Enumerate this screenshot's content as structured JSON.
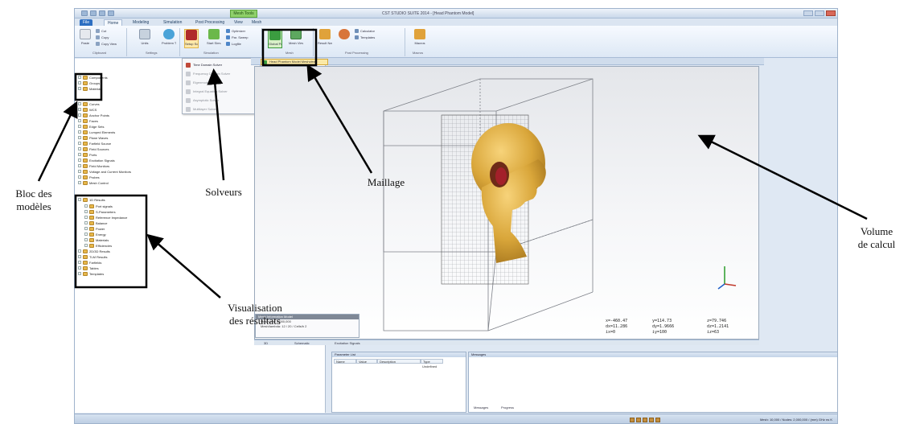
{
  "window": {
    "title": "CST STUDIO SUITE 2014 - [Head Phantom Model]",
    "context_tab": "Mesh Tools"
  },
  "ribbon": {
    "tabs": [
      "File",
      "Home",
      "Modeling",
      "Simulation",
      "Post Processing",
      "View",
      "Mesh"
    ],
    "groups": [
      "Clipboard",
      "Settings",
      "Simulation",
      "Mesh",
      "Post Processing",
      "Macros"
    ],
    "buttons": {
      "paste": "Paste",
      "units": "Units",
      "problem_type": "Problem Type",
      "setup_solver": "Setup Solver",
      "start_simulation": "Start Simulation",
      "global_properties": "Global Properties",
      "mesh_view": "Mesh View",
      "result_navigator": "Result Navigator",
      "macros": "Macros"
    },
    "small_buttons": [
      "Cut",
      "Copy",
      "Copy View",
      "Optimizer",
      "Par. Sweep",
      "Logfile",
      "Calculator",
      "Templates",
      "Results Templates"
    ]
  },
  "solver_menu": {
    "items": [
      "Time Domain Solver",
      "Frequency Domain Solver",
      "Eigenmode Solver",
      "Integral Equation Solver",
      "Asymptotic Solver",
      "Multilayer Solver"
    ]
  },
  "tree": {
    "model_block": [
      "Components",
      "Groups",
      "Materials"
    ],
    "items": [
      "Curves",
      "WCS",
      "Anchor Points",
      "Faces",
      "Edge Sets",
      "Lumped Elements",
      "Plane Waves",
      "Farfield Source",
      "Field Sources",
      "Ports",
      "Excitation Signals",
      "Field Monitors",
      "Voltage and Current Monitors",
      "Probes",
      "Mesh Control"
    ],
    "results_root": "1D Results",
    "results": [
      "Port signals",
      "S-Parameters",
      "Reference Impedance",
      "Balance",
      "Power",
      "Energy",
      "Materials",
      "Efficiencies"
    ],
    "after_results": [
      "2D/3D Results",
      "TLM Results",
      "Farfields",
      "Tables",
      "Templates"
    ]
  },
  "viewport": {
    "tab_label": "Head Phantom Model Meshview",
    "coords": {
      "x": "x=-460.47",
      "dx": "dx=11.286",
      "ix": "ix=0",
      "y": "y=114.73",
      "dy": "dy=1.9666",
      "iy": "iy=100",
      "z": "z=79.746",
      "dz": "dz=1.2141",
      "iz": "iz=63"
    },
    "info": {
      "title": "Mesh Information Model",
      "rows": [
        "Meshcells:    2,000,000",
        "Mesh/lambda:    12 / 20 / Cells/h 2"
      ]
    },
    "bottom_tabs": [
      "3D",
      "Schematic",
      "Excitation Signals"
    ]
  },
  "parameters": {
    "title": "Parameter List",
    "headers": [
      "Name",
      "Value",
      "Description",
      "Type"
    ],
    "rows": [
      [
        "",
        "",
        "",
        "Undefined"
      ]
    ]
  },
  "messages": {
    "title": "Messages",
    "tabs": [
      "Messages",
      "Progress"
    ]
  },
  "status": {
    "text": "Mesh: 10,000 / Nodes: 2,000,000 / (mm)  GHz  ns  K"
  },
  "annotations": {
    "model_block": [
      "Bloc des",
      "modèles"
    ],
    "solvers": "Solveurs",
    "mesh": "Maillage",
    "volume": [
      "Volume",
      "de calcul"
    ],
    "results": [
      "Visualisation",
      "des résultats"
    ]
  }
}
